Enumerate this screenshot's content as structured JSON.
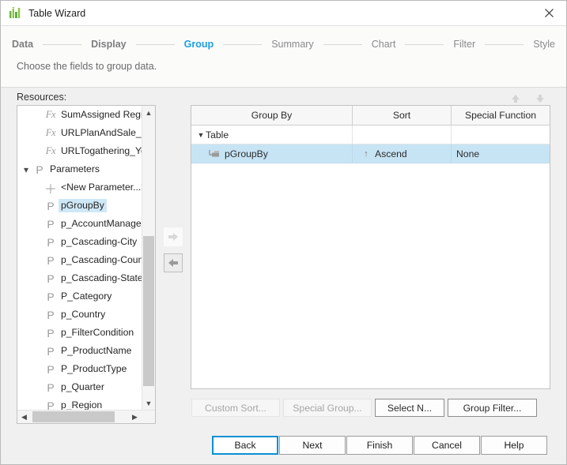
{
  "window": {
    "title": "Table Wizard",
    "app_icon": "bar-chart-icon",
    "close_label": "×"
  },
  "header": {
    "steps": [
      {
        "label": "Data",
        "state": "done"
      },
      {
        "label": "Display",
        "state": "done"
      },
      {
        "label": "Group",
        "state": "active"
      },
      {
        "label": "Summary",
        "state": "upcoming"
      },
      {
        "label": "Chart",
        "state": "upcoming"
      },
      {
        "label": "Filter",
        "state": "upcoming"
      },
      {
        "label": "Style",
        "state": "upcoming"
      }
    ],
    "subtitle": "Choose the fields to group data.",
    "active_color": "#1e9fe0"
  },
  "resources": {
    "label": "Resources:",
    "items": [
      {
        "icon": "fx-icon",
        "label": "SumAssigned Region",
        "indent": 2,
        "expander": "none",
        "selected": false
      },
      {
        "icon": "fx-icon",
        "label": "URLPlanAndSale_Year",
        "indent": 2,
        "expander": "none",
        "selected": false
      },
      {
        "icon": "fx-icon",
        "label": "URLTogathering_Year",
        "indent": 2,
        "expander": "none",
        "selected": false
      },
      {
        "icon": "p-icon",
        "label": "Parameters",
        "indent": 1,
        "expander": "expanded",
        "selected": false
      },
      {
        "icon": "plus-icon",
        "label": "<New Parameter...>",
        "indent": 2,
        "expander": "none",
        "selected": false
      },
      {
        "icon": "p-icon",
        "label": "pGroupBy",
        "indent": 2,
        "expander": "none",
        "selected": true
      },
      {
        "icon": "p-icon",
        "label": "p_AccountManagerNam",
        "indent": 2,
        "expander": "none",
        "selected": false
      },
      {
        "icon": "p-icon",
        "label": "p_Cascading-City",
        "indent": 2,
        "expander": "none",
        "selected": false
      },
      {
        "icon": "p-icon",
        "label": "p_Cascading-Country",
        "indent": 2,
        "expander": "none",
        "selected": false
      },
      {
        "icon": "p-icon",
        "label": "p_Cascading-State",
        "indent": 2,
        "expander": "none",
        "selected": false
      },
      {
        "icon": "p-icon",
        "label": "P_Category",
        "indent": 2,
        "expander": "none",
        "selected": false
      },
      {
        "icon": "p-icon",
        "label": "p_Country",
        "indent": 2,
        "expander": "none",
        "selected": false
      },
      {
        "icon": "p-icon",
        "label": "p_FilterCondition",
        "indent": 2,
        "expander": "none",
        "selected": false
      },
      {
        "icon": "p-icon",
        "label": "P_ProductName",
        "indent": 2,
        "expander": "none",
        "selected": false
      },
      {
        "icon": "p-icon",
        "label": "P_ProductType",
        "indent": 2,
        "expander": "none",
        "selected": false
      },
      {
        "icon": "p-icon",
        "label": "p_Quarter",
        "indent": 2,
        "expander": "none",
        "selected": false
      },
      {
        "icon": "p-icon",
        "label": "p_Region",
        "indent": 2,
        "expander": "none",
        "selected": false
      }
    ]
  },
  "transfer": {
    "add_label": "add-to-group",
    "remove_label": "remove-from-group"
  },
  "reorder": {
    "up_label": "move-up",
    "down_label": "move-down"
  },
  "grid": {
    "columns": [
      "Group By",
      "Sort",
      "Special Function"
    ],
    "rows": [
      {
        "type": "node",
        "group_by": "Table",
        "sort": "",
        "special_function": "",
        "selected": false,
        "expander": "expanded"
      },
      {
        "type": "field",
        "group_by": "pGroupBy",
        "sort": "Ascend",
        "sort_direction": "up-arrow-icon",
        "special_function": "None",
        "selected": true,
        "expander": "none"
      }
    ]
  },
  "actions": [
    {
      "id": "custom-sort",
      "label": "Custom Sort...",
      "enabled": false
    },
    {
      "id": "special-group",
      "label": "Special Group...",
      "enabled": false
    },
    {
      "id": "select-n",
      "label": "Select N...",
      "enabled": true
    },
    {
      "id": "group-filter",
      "label": "Group Filter...",
      "enabled": true
    }
  ],
  "footer": [
    {
      "id": "back",
      "label": "Back",
      "focused": true
    },
    {
      "id": "next",
      "label": "Next",
      "focused": false
    },
    {
      "id": "finish",
      "label": "Finish",
      "focused": false
    },
    {
      "id": "cancel",
      "label": "Cancel",
      "focused": false
    },
    {
      "id": "help",
      "label": "Help",
      "focused": false
    }
  ]
}
